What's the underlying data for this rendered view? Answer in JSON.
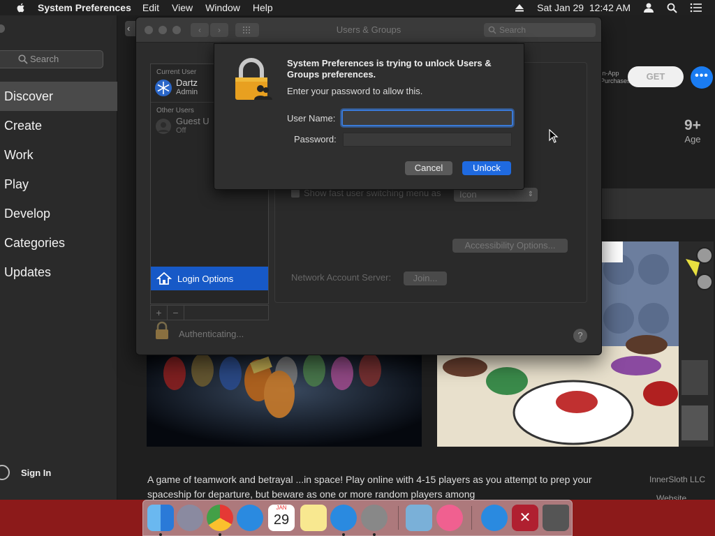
{
  "menubar": {
    "app_name": "System Preferences",
    "menus": [
      "Edit",
      "View",
      "Window",
      "Help"
    ],
    "datetime": "Sat Jan 29  12:42 AM"
  },
  "appstore": {
    "search_placeholder": "Search",
    "nav": [
      "Discover",
      "Create",
      "Work",
      "Play",
      "Develop",
      "Categories",
      "Updates"
    ],
    "active_nav": "Discover",
    "sign_in": "Sign In",
    "in_app_line1": "In-App",
    "in_app_line2": "Purchases",
    "get_label": "GET",
    "more_label": "•••",
    "age_value": "9+",
    "age_label": "Age",
    "description": "A game of teamwork and betrayal ...in space! Play online with 4-15 players as you attempt to prep your spaceship for departure, but beware as one or more random players among",
    "developer": "InnerSloth LLC",
    "website": "Website"
  },
  "prefs": {
    "title": "Users & Groups",
    "search_placeholder": "Search",
    "current_user_header": "Current User",
    "current_user_name": "Dartz",
    "current_user_role": "Admin",
    "other_users_header": "Other Users",
    "guest_name": "Guest U",
    "guest_status": "Off",
    "login_options": "Login Options",
    "fast_switch_label": "Show fast user switching menu as",
    "fast_switch_value": "Icon",
    "accessibility_btn": "Accessibility Options...",
    "network_label": "Network Account Server:",
    "join_btn": "Join...",
    "auth_status": "Authenticating...",
    "help": "?"
  },
  "dialog": {
    "title": "System Preferences is trying to unlock Users & Groups preferences.",
    "subtitle": "Enter your password to allow this.",
    "username_label": "User Name:",
    "username_value": "",
    "password_label": "Password:",
    "password_value": "",
    "cancel": "Cancel",
    "unlock": "Unlock"
  },
  "dock": {
    "calendar_month": "JAN",
    "calendar_day": "29",
    "items": [
      "finder-icon",
      "launchpad-icon",
      "chrome-icon",
      "safari-icon",
      "calendar-icon",
      "notes-icon",
      "app-store-icon",
      "system-preferences-icon",
      "preview-icon",
      "itunes-icon",
      "app-store-download-icon",
      "remove-icon",
      "trash-icon"
    ]
  },
  "colors": {
    "accent": "#1f6ae0",
    "selection": "#1759c7",
    "dock_bg": "#8c1a1a"
  }
}
